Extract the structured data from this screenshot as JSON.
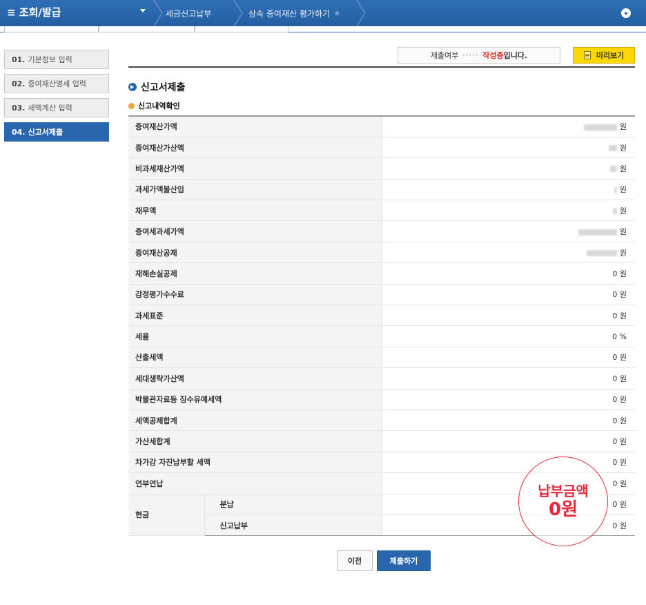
{
  "header": {
    "menu_icon": "hamburger-icon",
    "title": "≡ 조회/발급",
    "breadcrumbs": [
      "세금신고납부",
      "상속 증여재산 평가하기"
    ],
    "accent": "#255fa2"
  },
  "steps": [
    {
      "num": "01.",
      "label": "기본정보 입력",
      "active": false
    },
    {
      "num": "02.",
      "label": "증여재산명세 입력",
      "active": false
    },
    {
      "num": "03.",
      "label": "세액계산 입력",
      "active": false
    },
    {
      "num": "04.",
      "label": "신고서제출",
      "active": true
    }
  ],
  "status": {
    "prefix": "제출여부",
    "arrows": "›››››",
    "state": "작성중",
    "suffix": "입니다.",
    "preview_label": "미리보기"
  },
  "section": {
    "title": "신고서제출",
    "subtitle": "신고내역확인"
  },
  "rows": [
    {
      "label": "증여재산가액",
      "value": "원",
      "masked": true
    },
    {
      "label": "증여재산가산액",
      "value": "원",
      "masked": true
    },
    {
      "label": "비과세재산가액",
      "value": "원",
      "masked": true
    },
    {
      "label": "과세가액불산입",
      "value": "원",
      "masked": true
    },
    {
      "label": "채무액",
      "value": "원",
      "masked": true
    },
    {
      "label": "증여세과세가액",
      "value": "원",
      "masked": true
    },
    {
      "label": "증여재산공제",
      "value": "원",
      "masked": true
    },
    {
      "label": "재해손실공제",
      "value": "0 원"
    },
    {
      "label": "감정평가수수료",
      "value": "0 원"
    },
    {
      "label": "과세표준",
      "value": "0 원"
    },
    {
      "label": "세율",
      "value": "0 %"
    },
    {
      "label": "산출세액",
      "value": "0 원"
    },
    {
      "label": "세대생략가산액",
      "value": "0 원"
    },
    {
      "label": "박물관자료등 징수유예세액",
      "value": "0 원"
    },
    {
      "label": "세액공제합계",
      "value": "0 원"
    },
    {
      "label": "가산세합계",
      "value": "0 원"
    },
    {
      "label": "차가감 자진납부할 세액",
      "value": "0 원"
    },
    {
      "label": "연부연납",
      "value": "0 원"
    }
  ],
  "cash": {
    "label": "현금",
    "rows": [
      {
        "label": "분납",
        "value": "0 원"
      },
      {
        "label": "신고납부",
        "value": "0 원"
      }
    ]
  },
  "stamp": {
    "line1": "납부금액",
    "line2": "0원",
    "color": "#e8283a"
  },
  "buttons": {
    "prev": "이전",
    "submit": "제출하기"
  }
}
